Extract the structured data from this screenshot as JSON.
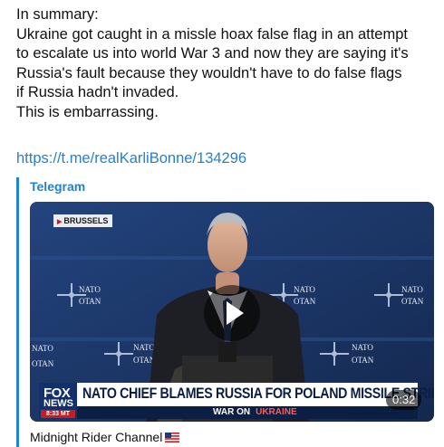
{
  "message": {
    "lines": [
      "In summary:",
      "Ukraine got caught in a missle hoax false flag in an attempt",
      "to escalate us into world War 3 and now they are saying it's",
      "Russia's fault because they wouldn't have to do false flags",
      "if Russia hadn't invaded.",
      "This is embarrassing."
    ],
    "link": "https://t.me/realKarliBonne/134296"
  },
  "embed": {
    "source": "Telegram",
    "video": {
      "dateline": "BRUSSELS",
      "backdrop_text": [
        "NATO",
        "OTAN"
      ],
      "headline": "NATO CHIEF BLAMES RUSSIA FOR POLAND MISSILE STRIKE",
      "subline": "WAR ON",
      "subline_tag": "UKRAINE",
      "network": "FOX",
      "network_sub": "NEWS",
      "time": "8:33 MT",
      "duration": "0:32"
    },
    "channel": "Midnight Rider Channel",
    "channel_flag_icon": "us-flag-icon"
  },
  "colors": {
    "link": "#2481cc",
    "backdrop": "#1b3566",
    "fox_blue": "#12306b",
    "fox_red": "#c41d24"
  }
}
